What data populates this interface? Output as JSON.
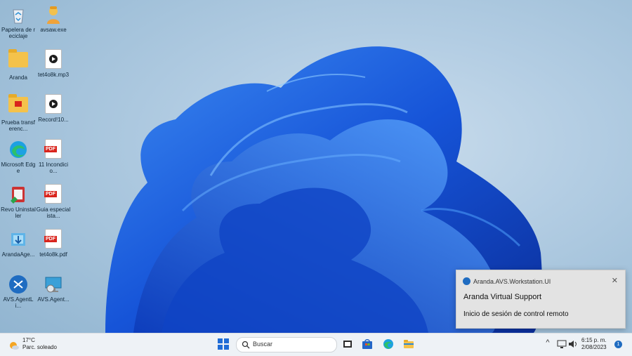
{
  "desktop": {
    "icons": [
      {
        "label": "Papelera de reciclaje",
        "icon": "recycle-bin-icon"
      },
      {
        "label": "avsaw.exe",
        "icon": "user-installer-icon"
      },
      {
        "label": "Aranda",
        "icon": "folder-icon"
      },
      {
        "label": "tet4o8k.mp3",
        "icon": "media-file-icon"
      },
      {
        "label": "Prueba transferenc...",
        "icon": "folder-icon"
      },
      {
        "label": "Record!10...",
        "icon": "media-file-icon"
      },
      {
        "label": "Microsoft Edge",
        "icon": "edge-icon"
      },
      {
        "label": "11 Incondicio...",
        "icon": "pdf-icon"
      },
      {
        "label": "Revo Uninstaller",
        "icon": "revo-uninstaller-icon"
      },
      {
        "label": "Guia especialista...",
        "icon": "pdf-icon"
      },
      {
        "label": "ArandaAge...",
        "icon": "installer-icon"
      },
      {
        "label": "tet4o8k.pdf",
        "icon": "pdf-icon"
      },
      {
        "label": "AVS.AgentLi...",
        "icon": "remote-agent-icon"
      },
      {
        "label": "AVS.Agent...",
        "icon": "agent-monitor-icon"
      }
    ]
  },
  "notification": {
    "app_name": "Aranda.AVS.Workstation.UI",
    "title": "Aranda Virtual Support",
    "message": "Inicio de sesión de control remoto",
    "close_glyph": "✕"
  },
  "taskbar": {
    "weather_temp": "17°C",
    "weather_desc": "Parc. soleado",
    "search_placeholder": "Buscar",
    "time": "6:15 p. m.",
    "date": "2/08/2023",
    "notification_count": "1",
    "tray_chevron": "^",
    "pdf_badge": "PDF"
  },
  "colors": {
    "accent": "#1f6cc1",
    "pdf_red": "#d9241c",
    "bloom_blue": "#1a5fe0"
  }
}
